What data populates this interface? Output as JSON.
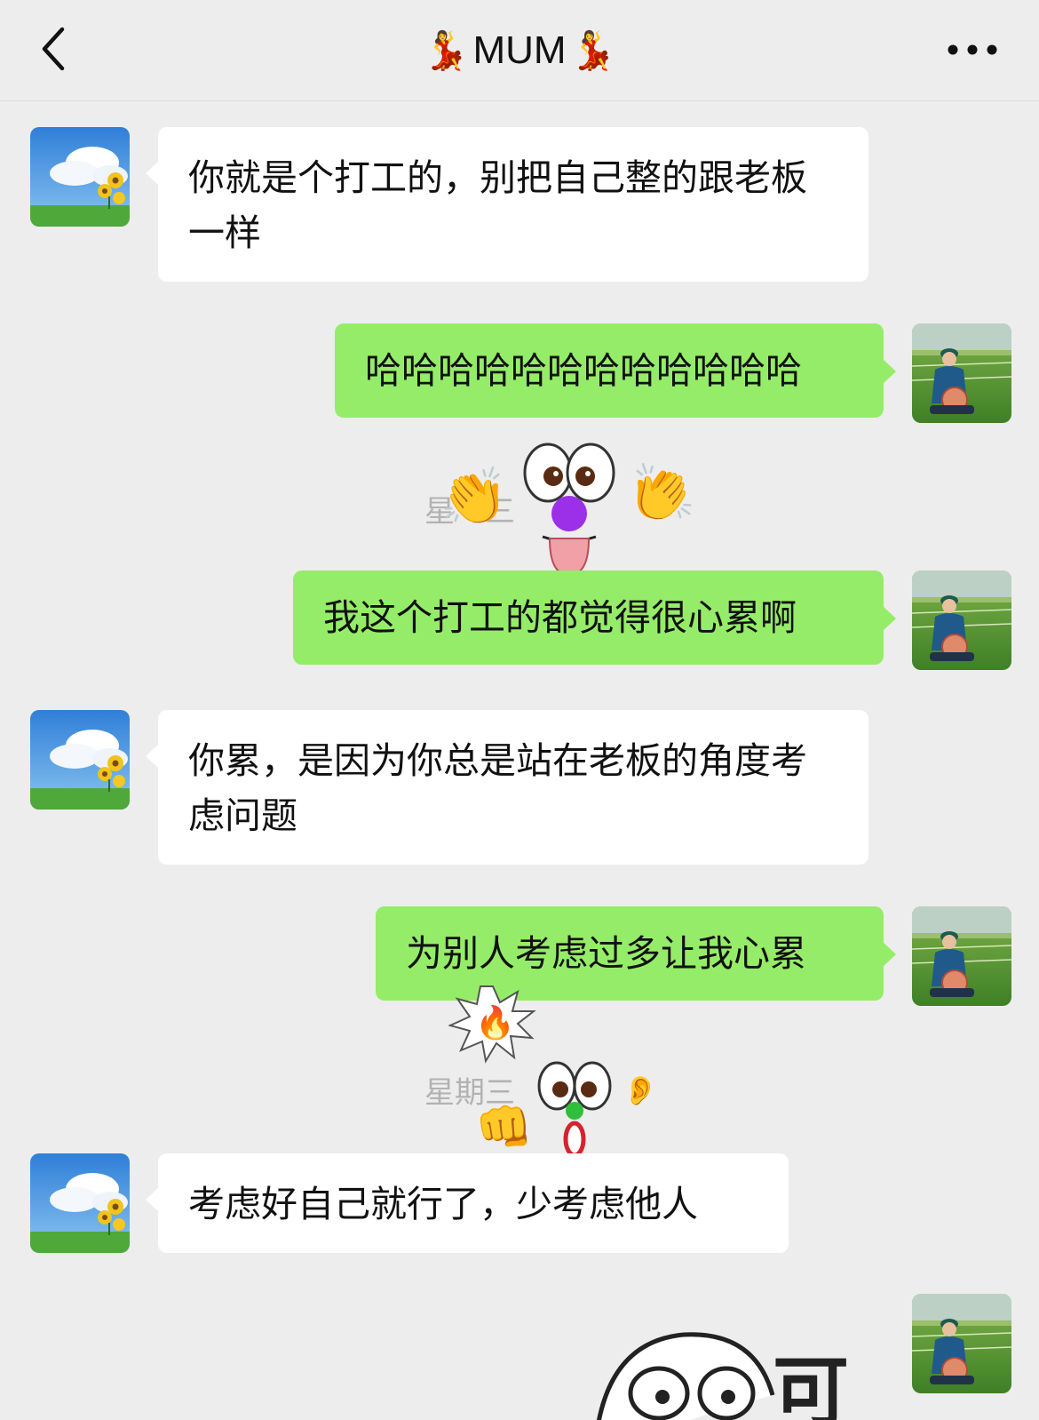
{
  "header": {
    "title": "MUM",
    "title_emoji": "💃"
  },
  "messages": [
    {
      "side": "in",
      "text": "你就是个打工的，别把自己整的跟老板一样"
    },
    {
      "side": "out",
      "text": "哈哈哈哈哈哈哈哈哈哈哈哈"
    },
    {
      "side": "out",
      "text": "我这个打工的都觉得很心累啊"
    },
    {
      "side": "in",
      "text": "你累，是因为你总是站在老板的角度考虑问题"
    },
    {
      "side": "out",
      "text": "为别人考虑过多让我心累"
    },
    {
      "side": "in",
      "text": "考虑好自己就行了，少考虑他人"
    }
  ],
  "timestamps": {
    "first_partial": "星",
    "first_partial_b": "三",
    "second": "星期三"
  },
  "stickers": {
    "clap_left": "👏",
    "clap_right": "👏",
    "fire": "🔥",
    "fist": "👊",
    "ear": "👂",
    "bottom_char": "可"
  },
  "colors": {
    "out_bubble": "#95ec69",
    "in_bubble": "#ffffff",
    "background": "#ededed"
  },
  "icons": [
    "back-chevron-icon",
    "more-dots-icon"
  ]
}
